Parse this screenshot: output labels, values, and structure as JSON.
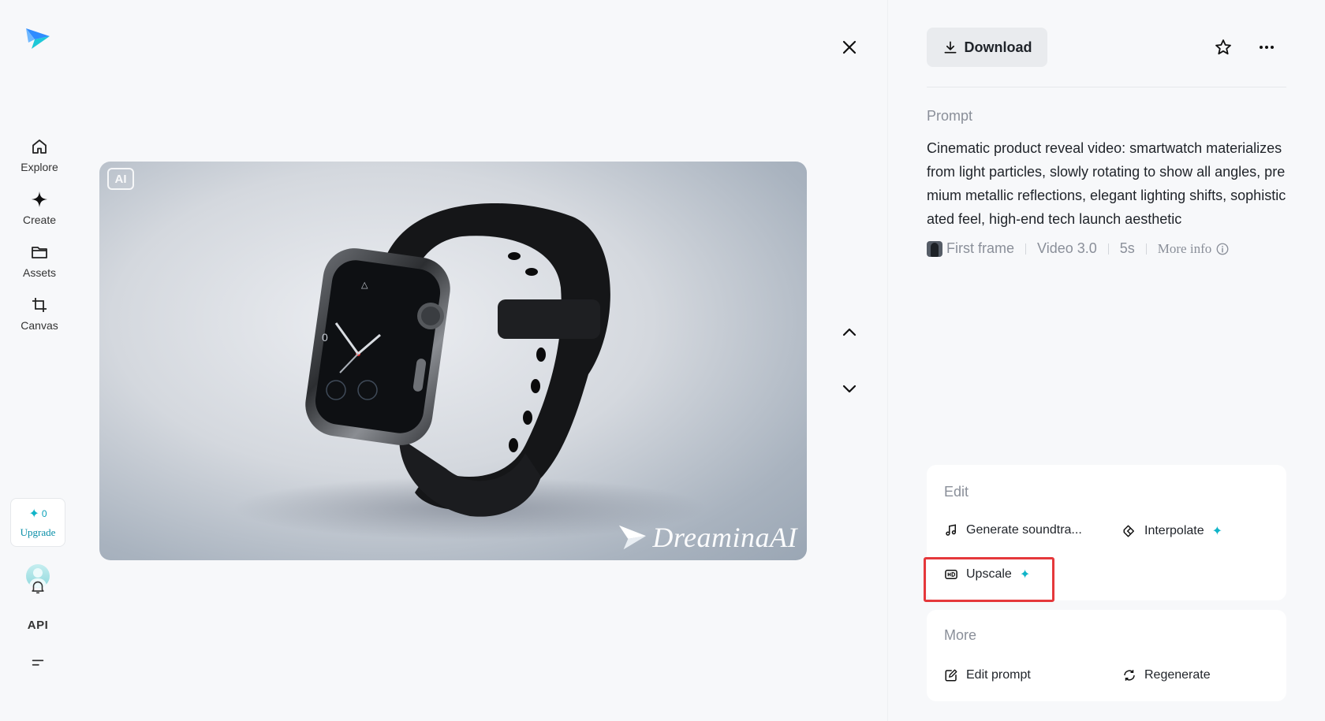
{
  "sidebar": {
    "logo": "dreamina-logo",
    "items": [
      {
        "label": "Explore",
        "icon": "home-icon"
      },
      {
        "label": "Create",
        "icon": "sparkle-icon"
      },
      {
        "label": "Assets",
        "icon": "folder-icon"
      },
      {
        "label": "Canvas",
        "icon": "crop-icon"
      }
    ],
    "credits_count": "0",
    "upgrade_label": "Upgrade",
    "api_label": "API"
  },
  "media": {
    "ai_badge": "AI",
    "watermark": "DreaminaAI"
  },
  "toolbar": {
    "download_label": "Download"
  },
  "prompt": {
    "heading": "Prompt",
    "text": "Cinematic product reveal video: smartwatch materializes from light particles, slowly rotating to show all angles, premium metallic reflections, elegant lighting shifts, sophisticated feel, high-end tech launch aesthetic",
    "meta": {
      "first_frame": "First frame",
      "model": "Video 3.0",
      "duration": "5s",
      "more_info": "More info"
    }
  },
  "edit": {
    "title": "Edit",
    "generate_soundtrack": "Generate soundtra...",
    "interpolate": "Interpolate",
    "upscale": "Upscale"
  },
  "more": {
    "title": "More",
    "edit_prompt": "Edit prompt",
    "regenerate": "Regenerate"
  },
  "colors": {
    "accent": "#10b4c8",
    "highlight": "#e5383b",
    "background": "#f7f8fa"
  }
}
